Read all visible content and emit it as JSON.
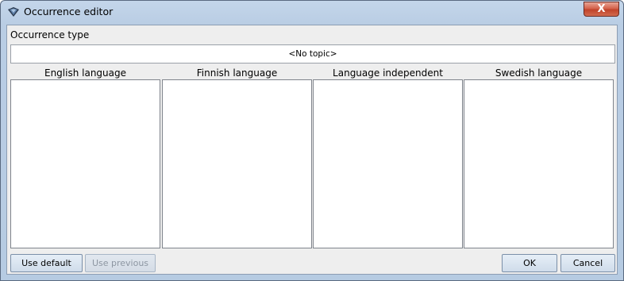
{
  "window": {
    "title": "Occurrence editor",
    "close_glyph": "X"
  },
  "occurrence_type": {
    "label": "Occurrence type",
    "value": "<No topic>"
  },
  "columns": [
    {
      "header": "English language"
    },
    {
      "header": "Finnish language"
    },
    {
      "header": "Language independent"
    },
    {
      "header": "Swedish language"
    }
  ],
  "buttons": {
    "use_default": "Use default",
    "use_previous": "Use previous",
    "ok": "OK",
    "cancel": "Cancel"
  },
  "icons": {
    "app": "diamond-logo-icon",
    "close": "close-icon"
  },
  "colors": {
    "close_button": "#c8442c",
    "titlebar": "#c4d6ea",
    "client_bg": "#eeeeee"
  }
}
